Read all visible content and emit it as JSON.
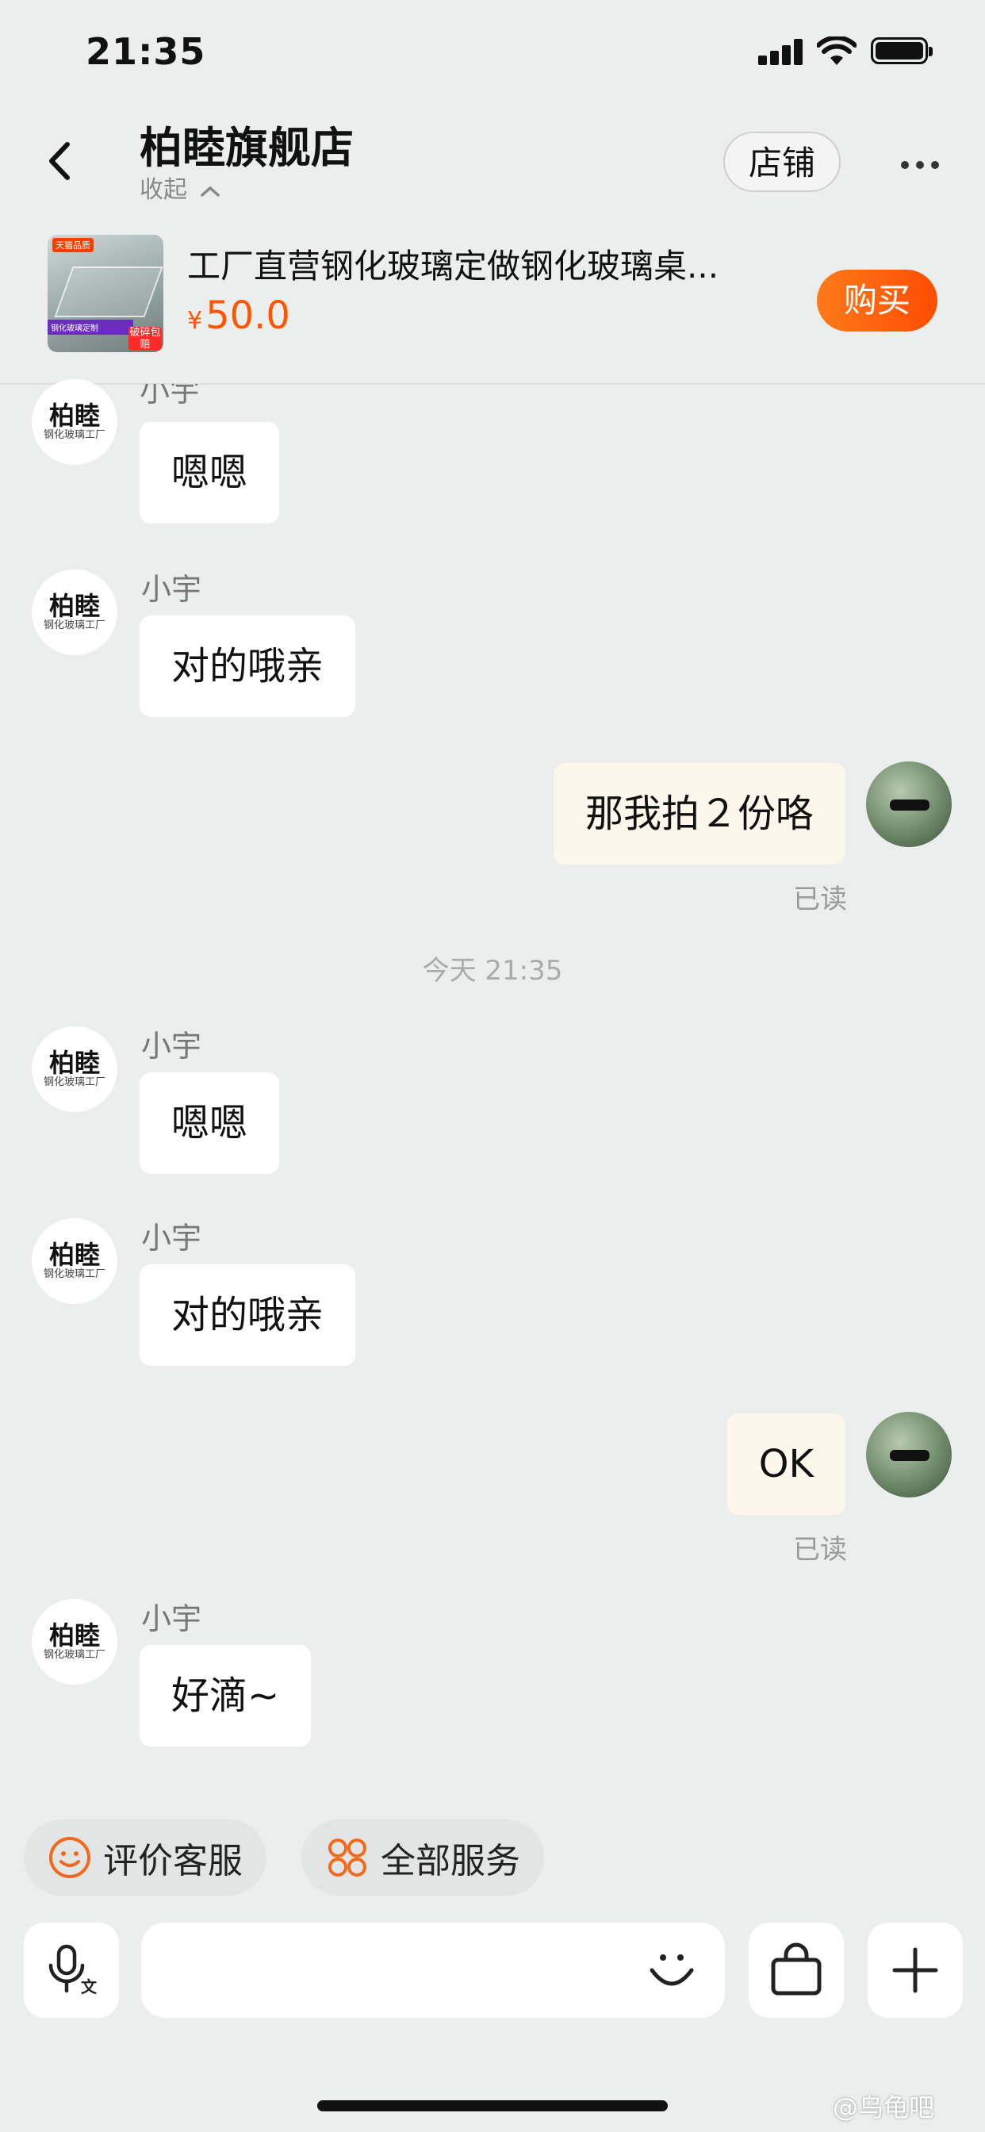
{
  "status_bar": {
    "time": "21:35"
  },
  "header": {
    "back_icon": "chevron-left-icon",
    "shop_name": "柏睦旗舰店",
    "collapse_label": "收起",
    "shop_button": "店铺",
    "more_icon": "more-icon"
  },
  "product": {
    "title": "工厂直营钢化玻璃定做钢化玻璃桌...",
    "currency": "¥",
    "price": "50.0",
    "buy_button": "购买",
    "image_badge_top": "天猫品质",
    "image_badge_bottom": "破碎包赔",
    "image_caption": "钢化玻璃定制"
  },
  "shop_avatar": {
    "line1": "柏睦",
    "line2": "钢化玻璃工厂"
  },
  "messages": [
    {
      "sender": "小宇",
      "text": "嗯嗯",
      "side": "left"
    },
    {
      "sender": "小宇",
      "text": "对的哦亲",
      "side": "left"
    },
    {
      "text": "那我拍２份咯",
      "side": "right",
      "status": "已读"
    },
    {
      "text": "OK",
      "side": "right",
      "status": "已读"
    },
    {
      "sender": "小宇",
      "text": "嗯嗯",
      "side": "left"
    },
    {
      "sender": "小宇",
      "text": "对的哦亲",
      "side": "left"
    },
    {
      "sender": "小宇",
      "text": "好滴~",
      "side": "left"
    }
  ],
  "timestamp_divider": "今天 21:35",
  "quick_actions": [
    {
      "label": "评价客服",
      "icon": "smiley-icon"
    },
    {
      "label": "全部服务",
      "icon": "grid-icon"
    }
  ],
  "input_bar": {
    "voice_icon": "voice-to-text-icon",
    "emoji_icon": "emoji-icon",
    "bag_icon": "shopping-bag-icon",
    "plus_icon": "plus-icon"
  },
  "watermark": "@乌龟吧",
  "colors": {
    "accent": "#ff5500",
    "background": "#eceeed",
    "my_bubble": "#fdf6ea"
  }
}
